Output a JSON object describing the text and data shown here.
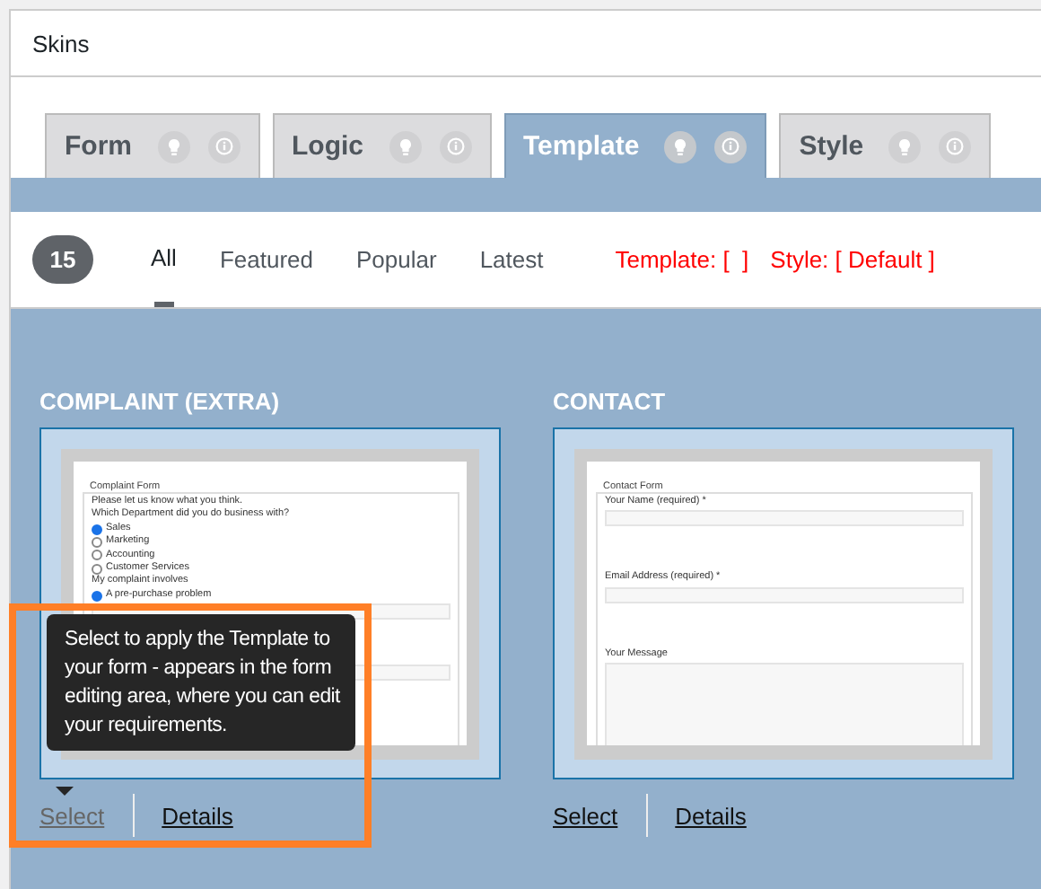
{
  "window": {
    "title": "Skins"
  },
  "tabs": [
    {
      "label": "Form",
      "selected": false
    },
    {
      "label": "Logic",
      "selected": false
    },
    {
      "label": "Template",
      "selected": true
    },
    {
      "label": "Style",
      "selected": false
    }
  ],
  "filter": {
    "count": "15",
    "items": [
      {
        "label": "All",
        "selected": true
      },
      {
        "label": "Featured",
        "selected": false
      },
      {
        "label": "Popular",
        "selected": false
      },
      {
        "label": "Latest",
        "selected": false
      }
    ],
    "template_label": "Template: [  ]",
    "style_label": "Style: [ Default ]"
  },
  "templates": [
    {
      "title": "COMPLAINT (EXTRA)",
      "preview": {
        "legend": "Complaint Form",
        "items": [
          {
            "kind": "text",
            "text": "Please let us know what you think."
          },
          {
            "kind": "text",
            "text": "Which Department did you do business with?"
          },
          {
            "kind": "radio",
            "text": "Sales",
            "checked": true
          },
          {
            "kind": "radio",
            "text": "Marketing",
            "checked": false
          },
          {
            "kind": "radio",
            "text": "Accounting",
            "checked": false
          },
          {
            "kind": "radio",
            "text": "Customer Services",
            "checked": false
          },
          {
            "kind": "text",
            "text": "My complaint involves"
          },
          {
            "kind": "radio",
            "text": "A pre-purchase problem",
            "checked": true
          },
          {
            "kind": "field"
          },
          {
            "kind": "field"
          }
        ]
      },
      "links": [
        {
          "label": "Select",
          "hovered": true
        },
        {
          "label": "Details",
          "hovered": false
        }
      ]
    },
    {
      "title": "CONTACT",
      "preview": {
        "legend": "Contact Form",
        "items": [
          {
            "kind": "text",
            "text": "Your Name (required) *"
          },
          {
            "kind": "field"
          },
          {
            "kind": "text",
            "text": "Email Address (required) *"
          },
          {
            "kind": "field"
          },
          {
            "kind": "text",
            "text": "Your Message"
          },
          {
            "kind": "textarea"
          }
        ]
      },
      "links": [
        {
          "label": "Select",
          "hovered": false
        },
        {
          "label": "Details",
          "hovered": false
        }
      ]
    }
  ],
  "tooltip": {
    "text": "Select to apply the Template to your form - appears in the form editing area, where you can edit your requirements."
  }
}
